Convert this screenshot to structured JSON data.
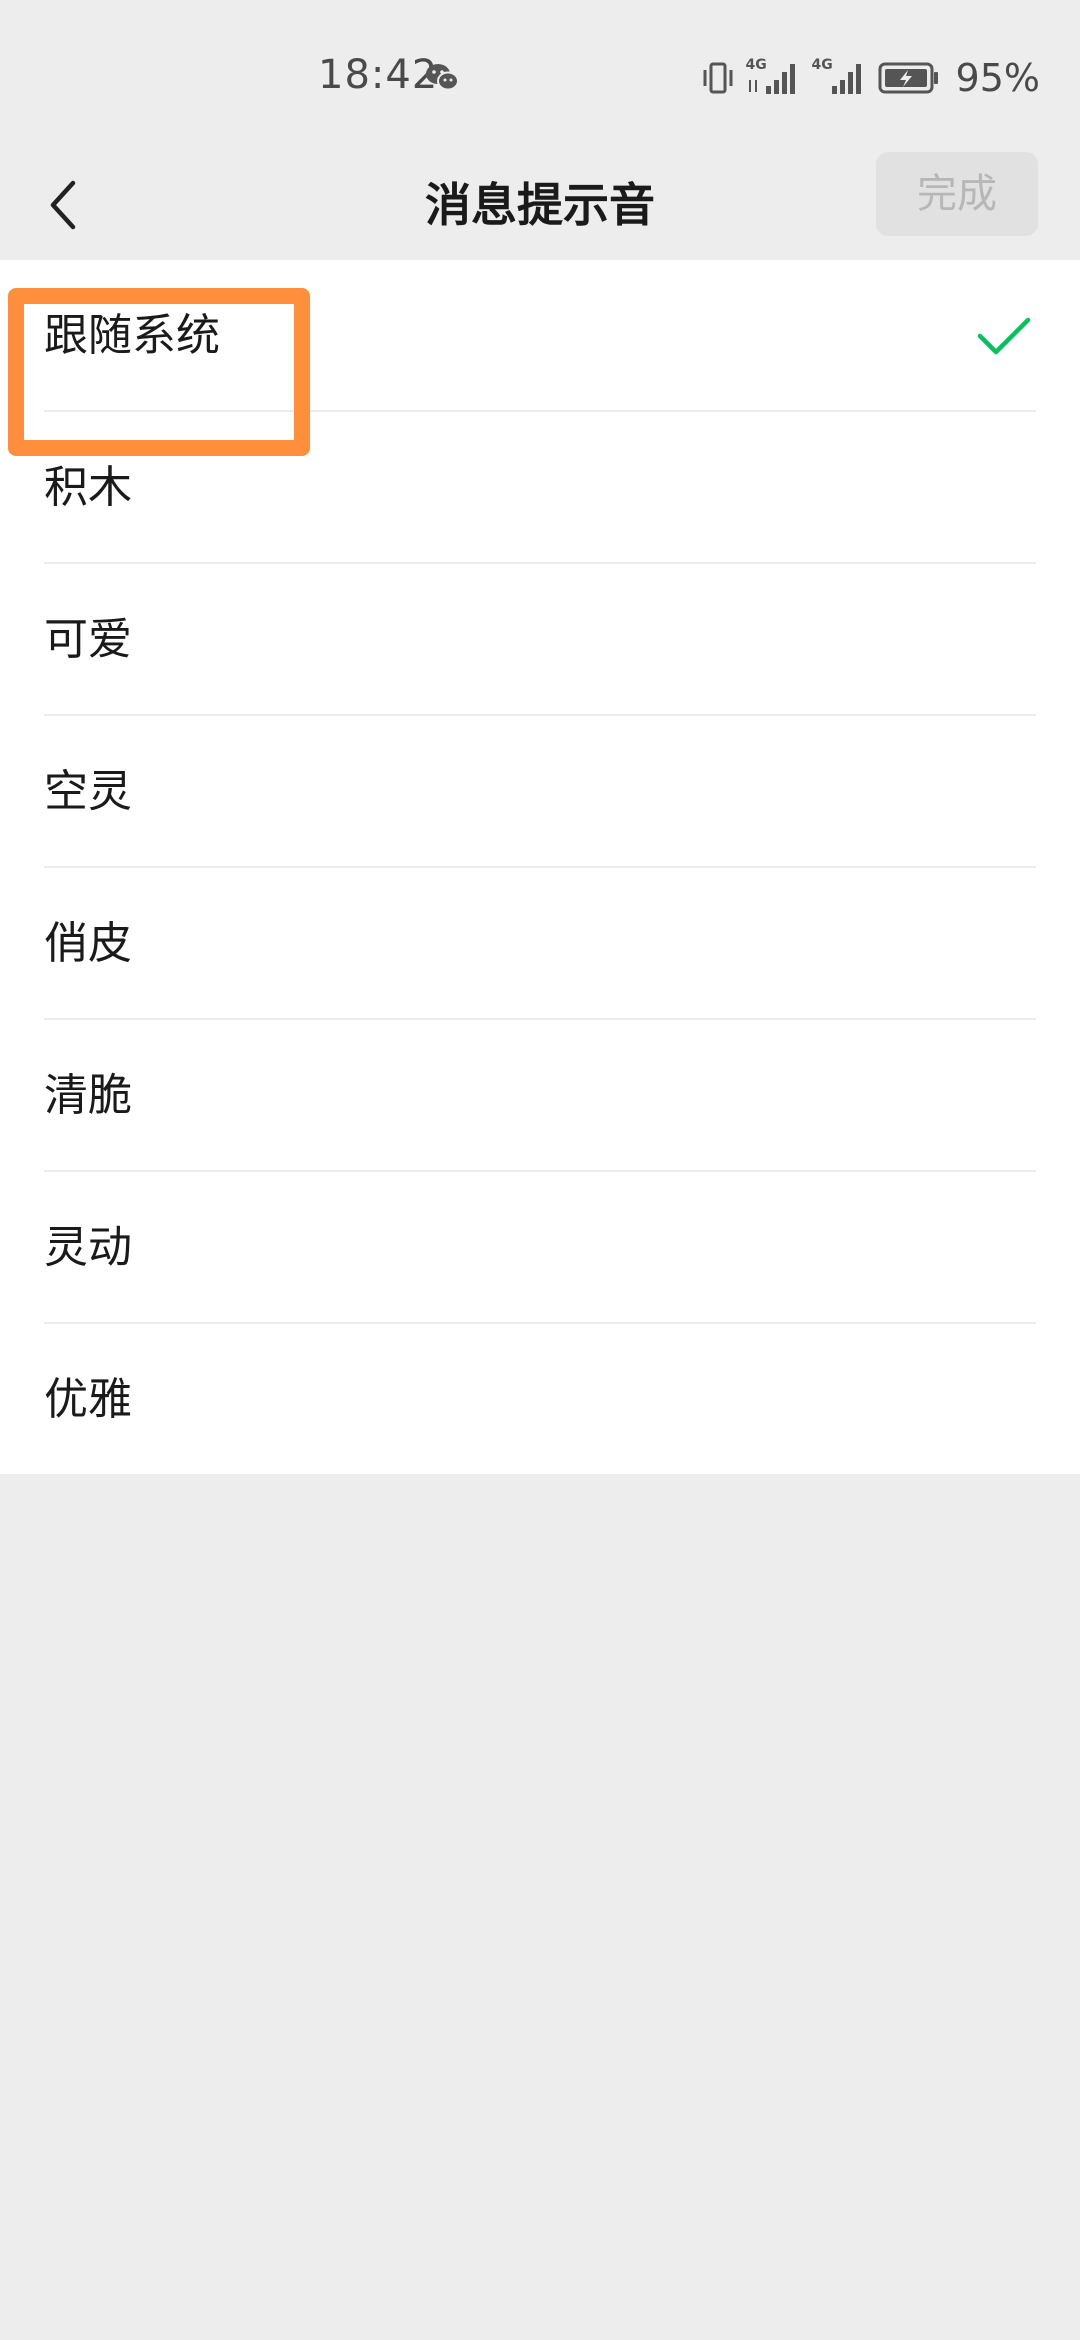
{
  "status_bar": {
    "time": "18:42",
    "network_tag_1": "4G",
    "network_tag_2": "4G",
    "battery_percent": "95%",
    "icons": [
      "wechat-icon",
      "vibrate-icon",
      "signal-icon",
      "battery-charging-icon"
    ]
  },
  "nav": {
    "title": "消息提示音",
    "done_label": "完成",
    "back_icon": "chevron-left-icon"
  },
  "sounds": [
    {
      "label": "跟随系统",
      "selected": true
    },
    {
      "label": "积木",
      "selected": false
    },
    {
      "label": "可爱",
      "selected": false
    },
    {
      "label": "空灵",
      "selected": false
    },
    {
      "label": "俏皮",
      "selected": false
    },
    {
      "label": "清脆",
      "selected": false
    },
    {
      "label": "灵动",
      "selected": false
    },
    {
      "label": "优雅",
      "selected": false
    }
  ],
  "colors": {
    "background": "#ededed",
    "list_background": "#ffffff",
    "check_green": "#07c160",
    "highlight_orange": "#ff8e3d",
    "done_disabled_bg": "#e1e1e1",
    "done_disabled_text": "#b7b7b7"
  }
}
